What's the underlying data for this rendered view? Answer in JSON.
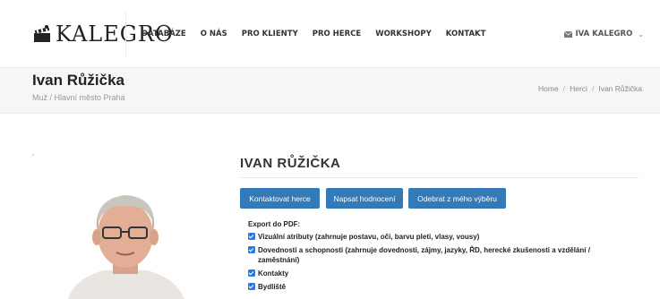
{
  "header": {
    "logo_text": "KALEGRO",
    "nav": [
      "DATABÁZE",
      "O NÁS",
      "PRO KLIENTY",
      "PRO HERCE",
      "WORKSHOPY",
      "KONTAKT"
    ],
    "user_label": "IVA KALEGRO"
  },
  "band": {
    "title": "Ivan Růžička",
    "subtitle": "Muž / Hlavní město Praha",
    "breadcrumb": [
      "Home",
      "Herci",
      "Ivan Růžička"
    ]
  },
  "profile": {
    "name": "IVAN RŮŽIČKA",
    "buttons": [
      "Kontaktovat herce",
      "Napsat hodnocení",
      "Odebrat z mého výběru"
    ],
    "export_title": "Export do PDF:",
    "export_options": [
      "Vizuální atributy (zahrnuje postavu, oči, barvu pleti, vlasy, vousy)",
      "Dovednosti a schopnosti (zahrnuje dovednosti, zájmy, jazyky, ŘD, herecké zkušenosti a vzdělání / zaměstnání)",
      "Kontakty",
      "Bydliště"
    ]
  },
  "colors": {
    "accent": "#337ab7",
    "checkbox": "#2a7ae2"
  }
}
